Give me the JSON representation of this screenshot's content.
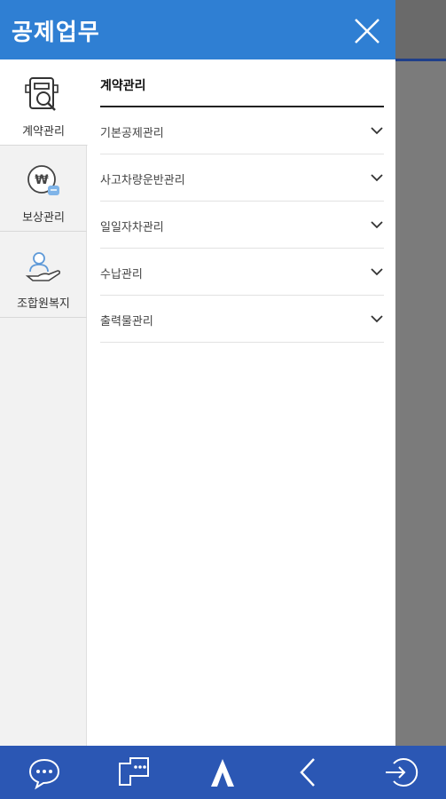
{
  "header": {
    "title": "공제업무",
    "close_icon": "close-icon",
    "color": "#2f7fd3"
  },
  "sidebar": {
    "items": [
      {
        "label": "계약관리",
        "icon": "document-search-icon",
        "active": true
      },
      {
        "label": "보상관리",
        "icon": "won-coin-icon",
        "active": false
      },
      {
        "label": "조합원복지",
        "icon": "person-hand-icon",
        "active": false
      }
    ]
  },
  "main": {
    "section_title": "계약관리",
    "menu": [
      {
        "label": "기본공제관리"
      },
      {
        "label": "사고차량운반관리"
      },
      {
        "label": "일일자차관리"
      },
      {
        "label": "수납관리"
      },
      {
        "label": "출력물관리"
      }
    ]
  },
  "bottom_bar": {
    "color": "#2b57b4",
    "buttons": [
      {
        "icon": "chat-bubble-icon"
      },
      {
        "icon": "message-board-icon"
      },
      {
        "icon": "logo-a-icon"
      },
      {
        "icon": "back-arrow-icon"
      },
      {
        "icon": "logout-icon"
      }
    ]
  }
}
